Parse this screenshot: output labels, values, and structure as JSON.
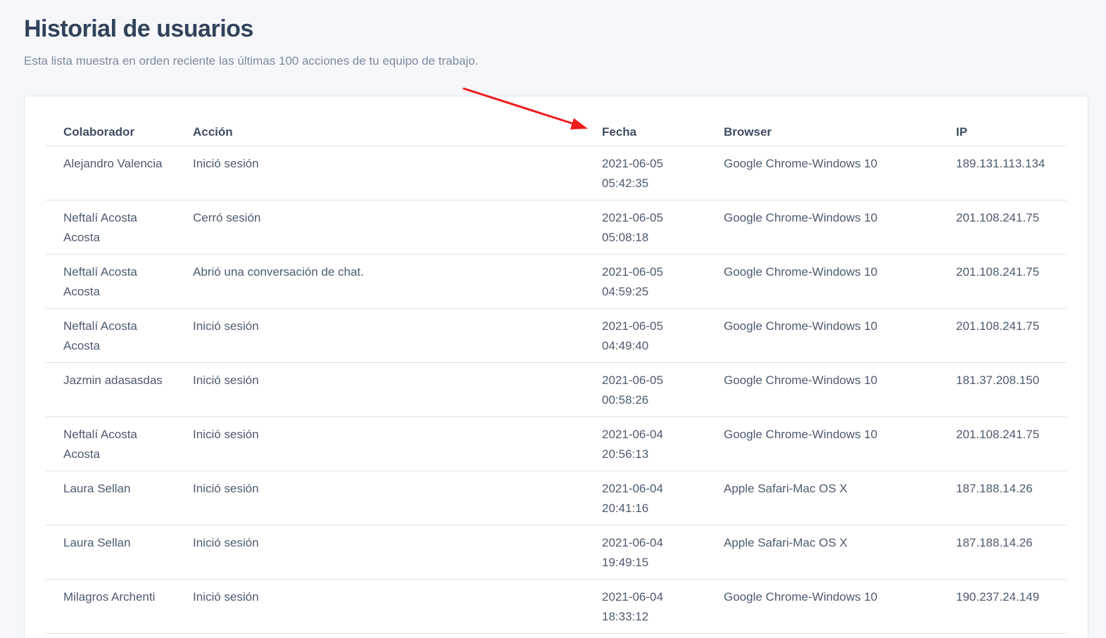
{
  "header": {
    "title": "Historial de usuarios",
    "subtitle": "Esta lista muestra en orden reciente las últimas 100 acciones de tu equipo de trabajo."
  },
  "table": {
    "columns": [
      "Colaborador",
      "Acción",
      "Fecha",
      "Browser",
      "IP"
    ],
    "rows": [
      {
        "colaborador": "Alejandro Valencia",
        "accion": "Inició sesión",
        "fecha": "2021-06-05 05:42:35",
        "browser": "Google Chrome-Windows 10",
        "ip": "189.131.113.134"
      },
      {
        "colaborador": "Neftalí Acosta Acosta",
        "accion": "Cerró sesión",
        "fecha": "2021-06-05 05:08:18",
        "browser": "Google Chrome-Windows 10",
        "ip": "201.108.241.75"
      },
      {
        "colaborador": "Neftalí Acosta Acosta",
        "accion": "Abrió una conversación de chat.",
        "fecha": "2021-06-05 04:59:25",
        "browser": "Google Chrome-Windows 10",
        "ip": "201.108.241.75"
      },
      {
        "colaborador": "Neftalí Acosta Acosta",
        "accion": "Inició sesión",
        "fecha": "2021-06-05 04:49:40",
        "browser": "Google Chrome-Windows 10",
        "ip": "201.108.241.75"
      },
      {
        "colaborador": "Jazmin adasasdas",
        "accion": "Inició sesión",
        "fecha": "2021-06-05 00:58:26",
        "browser": "Google Chrome-Windows 10",
        "ip": "181.37.208.150"
      },
      {
        "colaborador": "Neftalí Acosta Acosta",
        "accion": "Inició sesión",
        "fecha": "2021-06-04 20:56:13",
        "browser": "Google Chrome-Windows 10",
        "ip": "201.108.241.75"
      },
      {
        "colaborador": "Laura Sellan",
        "accion": "Inició sesión",
        "fecha": "2021-06-04 20:41:16",
        "browser": "Apple Safari-Mac OS X",
        "ip": "187.188.14.26"
      },
      {
        "colaborador": "Laura Sellan",
        "accion": "Inició sesión",
        "fecha": "2021-06-04 19:49:15",
        "browser": "Apple Safari-Mac OS X",
        "ip": "187.188.14.26"
      },
      {
        "colaborador": "Milagros Archenti",
        "accion": "Inició sesión",
        "fecha": "2021-06-04 18:33:12",
        "browser": "Google Chrome-Windows 10",
        "ip": "190.237.24.149"
      }
    ]
  },
  "annotation": {
    "icon": "red-arrow-icon",
    "color": "#ee1c1c"
  }
}
